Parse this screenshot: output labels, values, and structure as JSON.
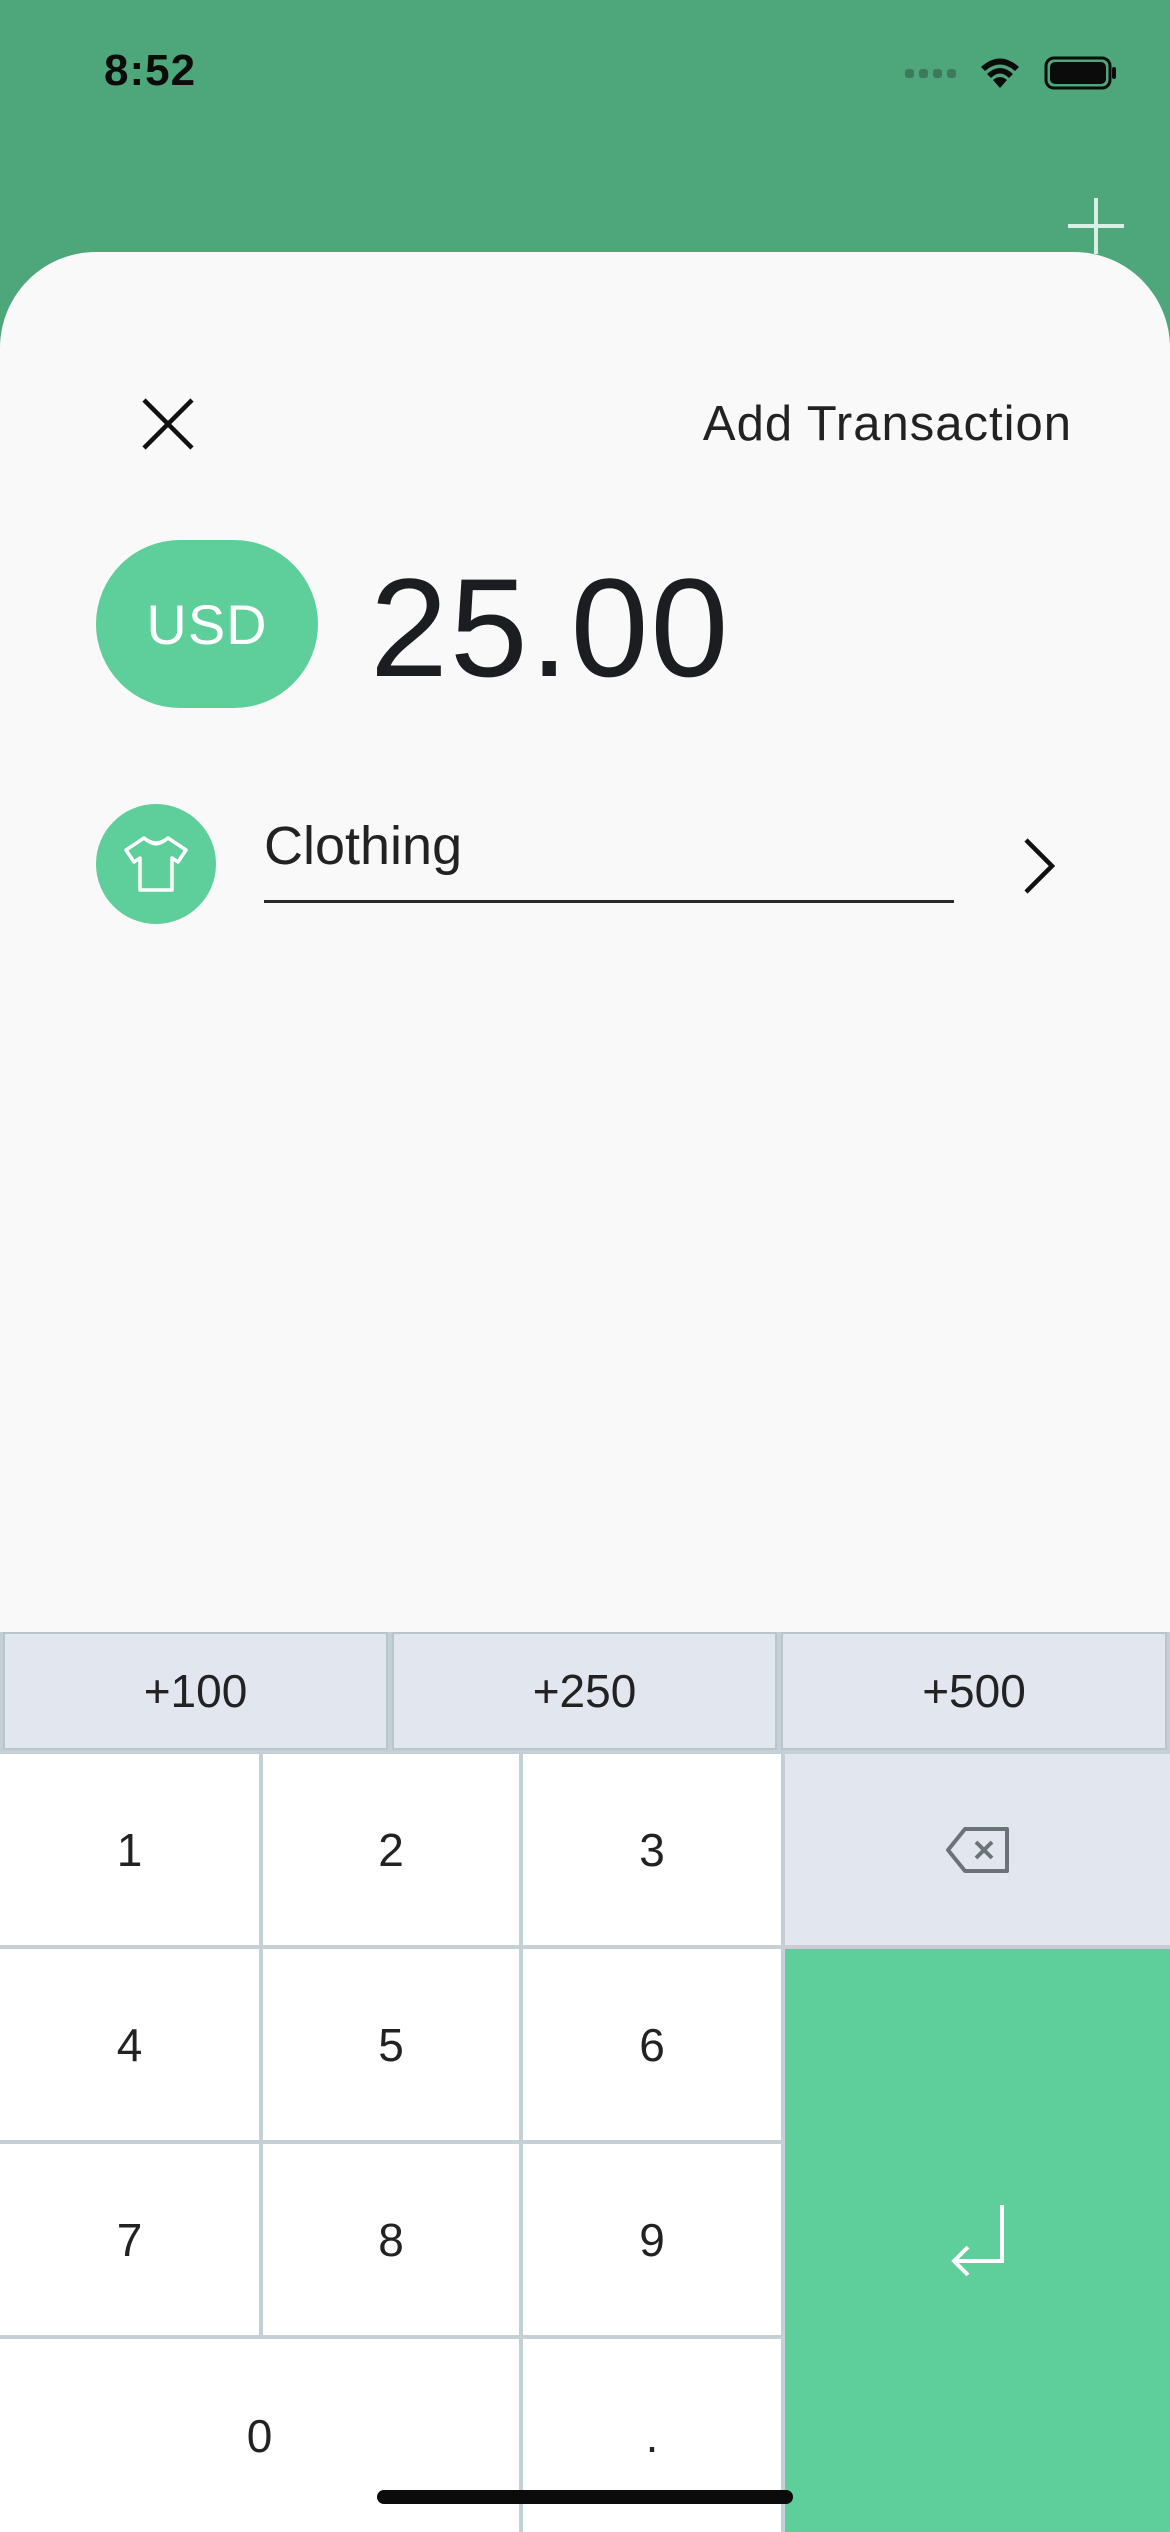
{
  "status_bar": {
    "time": "8:52"
  },
  "sheet": {
    "title": "Add Transaction",
    "currency": "USD",
    "amount": "25.00",
    "category": {
      "label": "Clothing",
      "icon": "tshirt-icon"
    }
  },
  "keypad": {
    "quick_add": [
      "+100",
      "+250",
      "+500"
    ],
    "keys": {
      "k1": "1",
      "k2": "2",
      "k3": "3",
      "k4": "4",
      "k5": "5",
      "k6": "6",
      "k7": "7",
      "k8": "8",
      "k9": "9",
      "k0": "0",
      "dot": "."
    }
  },
  "colors": {
    "header_green": "#4EA77A",
    "accent_green": "#5ECE9A",
    "sheet_background": "#F9F9F9",
    "keypad_grey": "#E2E7EF"
  }
}
